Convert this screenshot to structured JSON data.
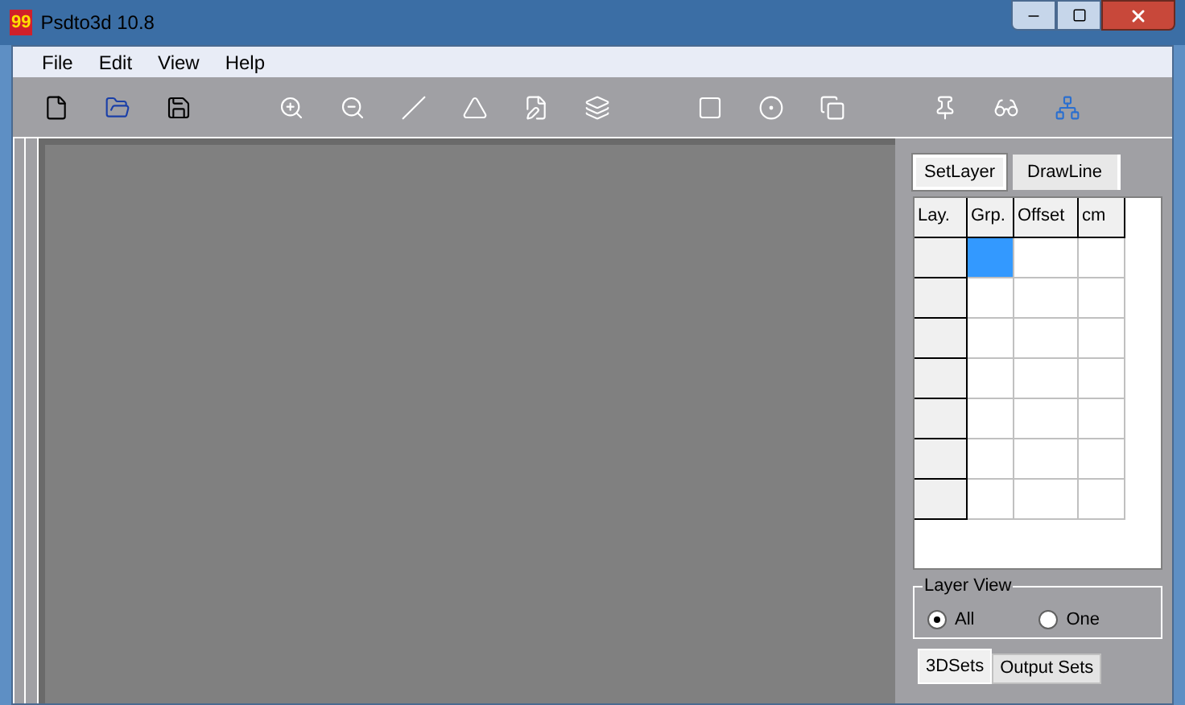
{
  "window": {
    "title": "Psdto3d 10.8",
    "logo": "99"
  },
  "menu": [
    "File",
    "Edit",
    "View",
    "Help"
  ],
  "toolbar": [
    {
      "kind": "new"
    },
    {
      "kind": "open"
    },
    {
      "kind": "save"
    },
    {
      "kind": "zoom-in"
    },
    {
      "kind": "zoom-out"
    },
    {
      "kind": "line"
    },
    {
      "kind": "angle"
    },
    {
      "kind": "page-edit"
    },
    {
      "kind": "layers-edit"
    },
    {
      "kind": "frame"
    },
    {
      "kind": "target"
    },
    {
      "kind": "copy"
    },
    {
      "kind": "pin"
    },
    {
      "kind": "glasses"
    },
    {
      "kind": "network"
    }
  ],
  "panel_tabs": [
    {
      "label": "SetLayer",
      "selected": true
    },
    {
      "label": "DrawLine",
      "selected": false
    }
  ],
  "table": {
    "columns": [
      "Lay.",
      "Grp.",
      "Offset",
      "cm"
    ],
    "rows": [
      {
        "cells": [
          {
            "selected": true
          },
          {
            "selected": false
          },
          {
            "selected": false
          }
        ]
      },
      {
        "cells": [
          {
            "selected": false
          },
          {
            "selected": false
          },
          {
            "selected": false
          }
        ]
      },
      {
        "cells": [
          {
            "selected": false
          },
          {
            "selected": false
          },
          {
            "selected": false
          }
        ]
      },
      {
        "cells": [
          {
            "selected": false
          },
          {
            "selected": false
          },
          {
            "selected": false
          }
        ]
      },
      {
        "cells": [
          {
            "selected": false
          },
          {
            "selected": false
          },
          {
            "selected": false
          }
        ]
      },
      {
        "cells": [
          {
            "selected": false
          },
          {
            "selected": false
          },
          {
            "selected": false
          }
        ]
      },
      {
        "cells": [
          {
            "selected": false
          },
          {
            "selected": false
          },
          {
            "selected": false
          }
        ]
      }
    ]
  },
  "layer_view": {
    "title": "Layer View",
    "options": [
      {
        "label": "All",
        "selected": true
      },
      {
        "label": "One",
        "selected": false
      }
    ]
  },
  "bottom_tabs": [
    {
      "label": "3DSets",
      "selected": true
    },
    {
      "label": "Output Sets",
      "selected": false
    }
  ]
}
